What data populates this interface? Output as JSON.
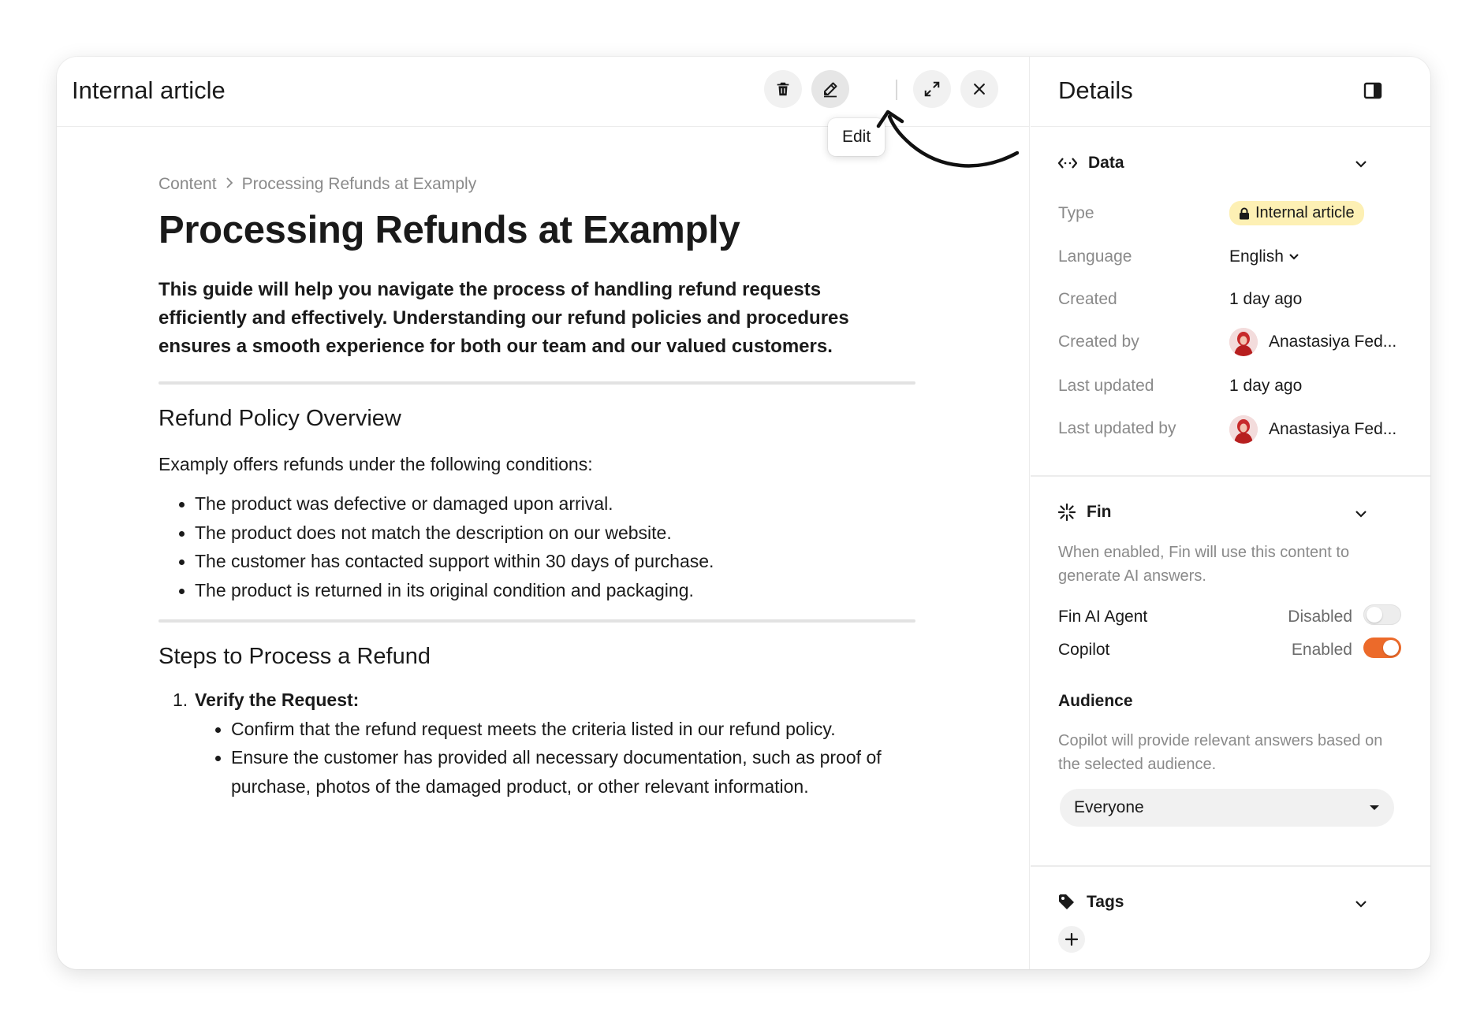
{
  "header": {
    "title": "Internal article",
    "tooltip": "Edit",
    "icons": [
      "trash-icon",
      "pencil-icon",
      "expand-icon",
      "close-icon"
    ]
  },
  "article": {
    "breadcrumb": [
      "Content",
      "Processing Refunds at Examply"
    ],
    "title": "Processing Refunds at Examply",
    "lead": "This guide will help you navigate the process of handling refund requests efficiently and effectively. Understanding our refund policies and procedures ensures a smooth experience for both our team and our valued customers.",
    "section1": {
      "heading": "Refund Policy Overview",
      "intro": "Examply offers refunds under the following conditions:",
      "bullets": [
        "The product was defective or damaged upon arrival.",
        "The product does not match the description on our website.",
        "The customer has contacted support within 30 days of purchase.",
        "The product is returned in its original condition and packaging."
      ]
    },
    "section2": {
      "heading": "Steps to Process a Refund",
      "steps": [
        {
          "number": "1.",
          "title": "Verify the Request:",
          "bullets": [
            "Confirm that the refund request meets the criteria listed in our refund policy.",
            "Ensure the customer has provided all necessary documentation, such as proof of purchase, photos of the damaged product, or other relevant information."
          ]
        }
      ]
    }
  },
  "details": {
    "title": "Details",
    "data": {
      "heading": "Data",
      "type_label": "Type",
      "type_value": "Internal article",
      "language_label": "Language",
      "language_value": "English",
      "created_label": "Created",
      "created_value": "1 day ago",
      "created_by_label": "Created by",
      "created_by_value": "Anastasiya Fed...",
      "updated_label": "Last updated",
      "updated_value": "1 day ago",
      "updated_by_label": "Last updated by",
      "updated_by_value": "Anastasiya Fed..."
    },
    "fin": {
      "heading": "Fin",
      "description": "When enabled, Fin will use this content to generate AI answers.",
      "agent_label": "Fin AI Agent",
      "agent_state": "Disabled",
      "agent_enabled": false,
      "copilot_label": "Copilot",
      "copilot_state": "Enabled",
      "copilot_enabled": true,
      "audience_title": "Audience",
      "audience_description": "Copilot will provide relevant answers based on the selected audience.",
      "audience_value": "Everyone"
    },
    "tags": {
      "heading": "Tags"
    }
  },
  "colors": {
    "accent": "#ec6a2a",
    "badge": "#fdf0b4",
    "muted_text": "#8a8a8a"
  }
}
